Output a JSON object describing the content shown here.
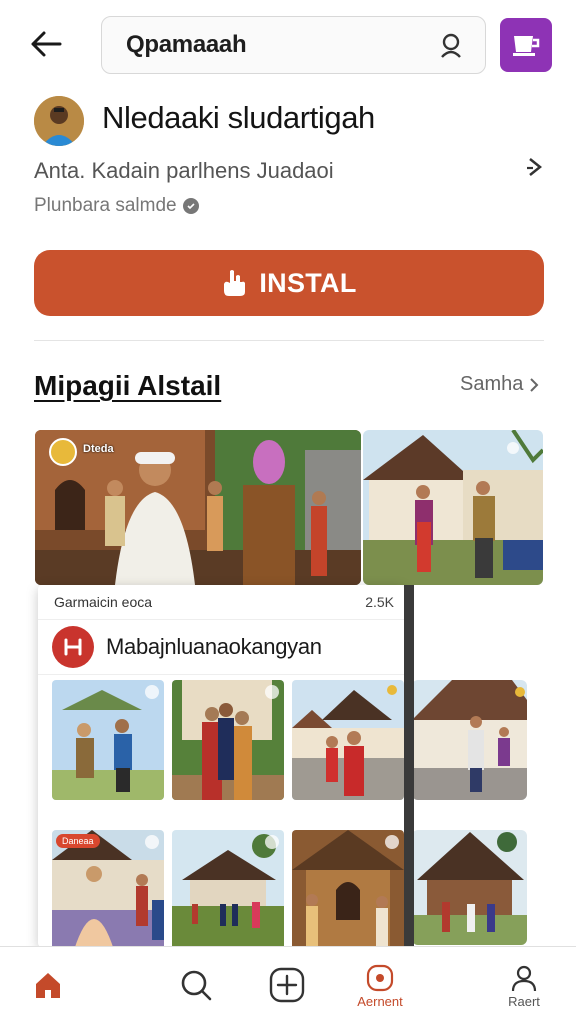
{
  "search": {
    "query": "Qpamaaah"
  },
  "profile": {
    "name": "Nledaaki sludartigah",
    "subtitle": "Anta. Kadain parlhens Juadaoi",
    "meta": "Plunbara salmde"
  },
  "install": {
    "label": "INSTAL"
  },
  "section": {
    "title": "Mipagii Alstail",
    "see_all": "Samha"
  },
  "big_photo": {
    "tag": "Dteda"
  },
  "popup": {
    "caption": "Garmaicin eoca",
    "count": "2.5K",
    "header": "Mabajnluanaokangyan",
    "thumb_tag": "Daneaa"
  },
  "nav": {
    "home": "",
    "search": "",
    "create": "",
    "activity": "Aernent",
    "profile": "Raert"
  },
  "colors": {
    "accent": "#c9522d",
    "store": "#8e33b5",
    "popup_icon": "#c9342d"
  }
}
